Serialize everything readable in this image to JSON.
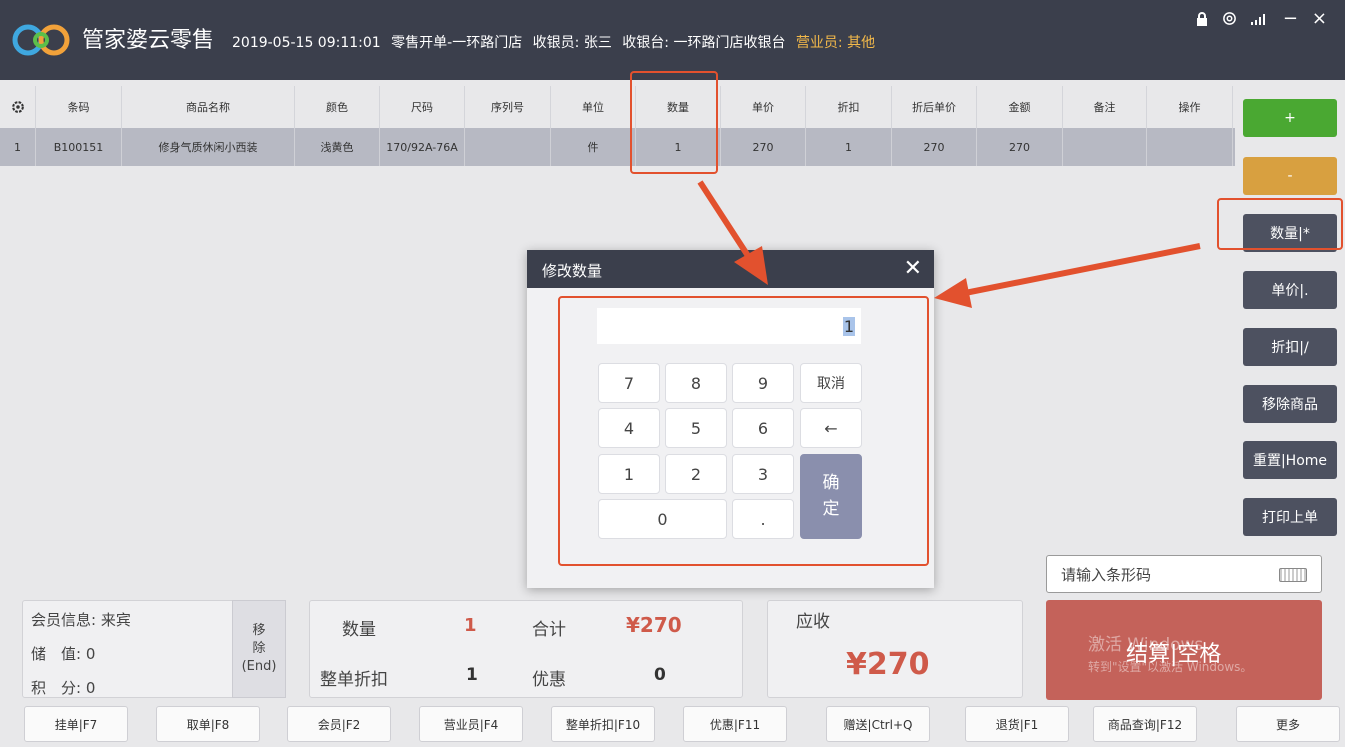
{
  "header": {
    "app_title": "管家婆云零售",
    "datetime": "2019-05-15 09:11:01",
    "mode": "零售开单",
    "store": "-一环路门店",
    "cashier": "收银员: 张三",
    "register": "收银台: 一环路门店收银台",
    "salesperson": "营业员: 其他",
    "icons": [
      "lock-icon",
      "gear-icon",
      "signal-icon",
      "minimize-icon",
      "close-icon"
    ],
    "minimize_glyph": "−",
    "close_glyph": "×"
  },
  "table": {
    "settings_icon": "gear-icon",
    "columns": [
      "条码",
      "商品名称",
      "颜色",
      "尺码",
      "序列号",
      "单位",
      "数量",
      "单价",
      "折扣",
      "折后单价",
      "金额",
      "备注",
      "操作"
    ],
    "rows": [
      [
        "1",
        "B100151",
        "修身气质休闲小西装",
        "浅黄色",
        "170/92A-76A",
        "",
        "件",
        "1",
        "270",
        "1",
        "270",
        "270",
        "",
        ""
      ]
    ]
  },
  "side_buttons": [
    "+",
    "-",
    "数量|*",
    "单价|.",
    "折扣|/",
    "移除商品",
    "重置|Home",
    "打印上单"
  ],
  "dialog": {
    "title": "修改数量",
    "close": "✕",
    "value": "1",
    "keys": {
      "k7": "7",
      "k8": "8",
      "k9": "9",
      "cancel": "取消",
      "k4": "4",
      "k5": "5",
      "k6": "6",
      "backspace": "←",
      "k1": "1",
      "k2": "2",
      "k3": "3",
      "ok_a": "确",
      "ok_b": "定",
      "k0": "0",
      "dot": "."
    }
  },
  "barcode": {
    "placeholder": "请输入条形码"
  },
  "member": {
    "info": "会员信息: 来宾",
    "balance": "储　值: 0",
    "points": "积　分: 0",
    "remove_a": "移",
    "remove_b": "除",
    "remove_c": "(End)"
  },
  "summary": {
    "qty_label": "数量",
    "qty": "1",
    "total_label": "合计",
    "total": "¥270",
    "discount_label": "整单折扣",
    "discount": "1",
    "promo_label": "优惠",
    "promo": "0"
  },
  "receivable": {
    "label": "应收",
    "amount": "¥270"
  },
  "checkout": {
    "label": "结算|空格",
    "watermark1": "激活 Windows",
    "watermark2": "转到\"设置\"以激活 Windows。"
  },
  "footer": [
    "挂单|F7",
    "取单|F8",
    "会员|F2",
    "营业员|F4",
    "整单折扣|F10",
    "优惠|F11",
    "赠送|Ctrl+Q",
    "退货|F1",
    "商品查询|F12",
    "更多"
  ]
}
